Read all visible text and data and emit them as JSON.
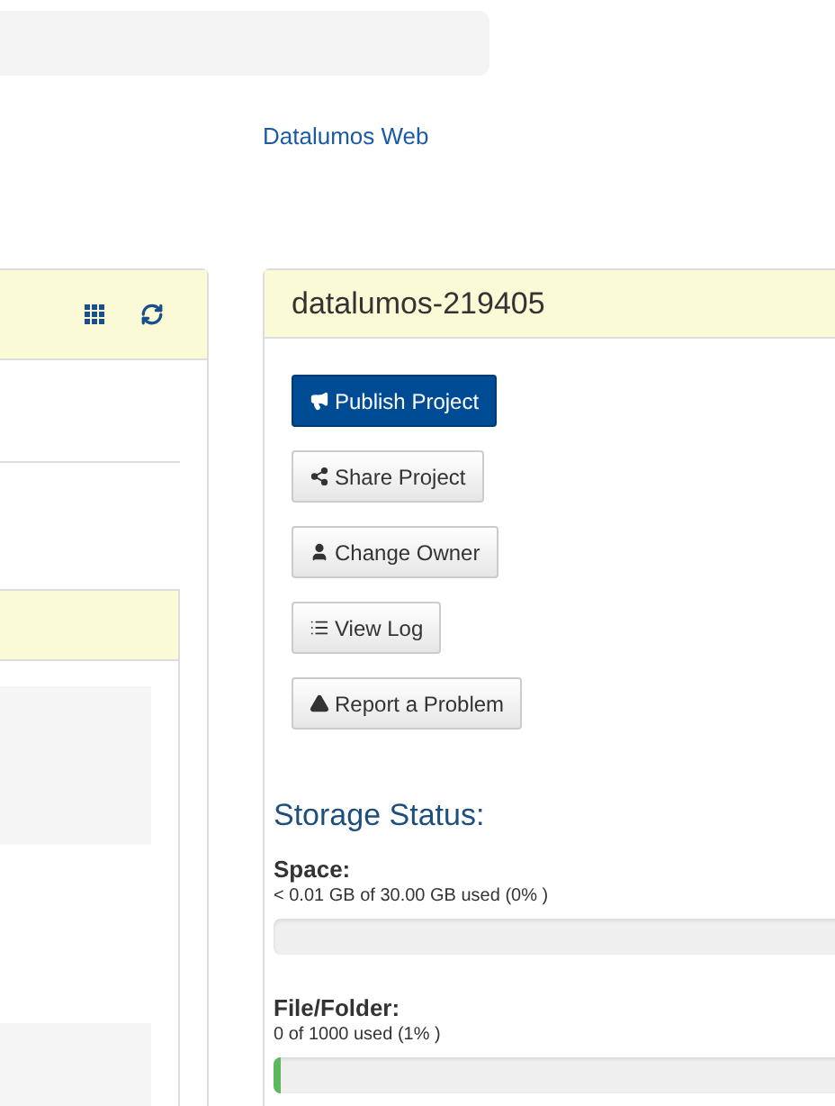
{
  "link": "Datalumos Web",
  "project": {
    "title": "datalumos-219405",
    "buttons": [
      {
        "label": "Publish Project",
        "kind": "primary"
      },
      {
        "label": "Share Project",
        "kind": "default"
      },
      {
        "label": "Change Owner",
        "kind": "default"
      },
      {
        "label": "View Log",
        "kind": "default"
      },
      {
        "label": "Report a Problem",
        "kind": "default"
      }
    ]
  },
  "storage": {
    "heading": "Storage Status:",
    "items": [
      {
        "label": "Space:",
        "reading": "< 0.01 GB of 30.00 GB used (0% )",
        "level": 0
      },
      {
        "label": "File/Folder:",
        "reading": "0 of 1000 used (1% )",
        "level": 0.01
      }
    ]
  }
}
